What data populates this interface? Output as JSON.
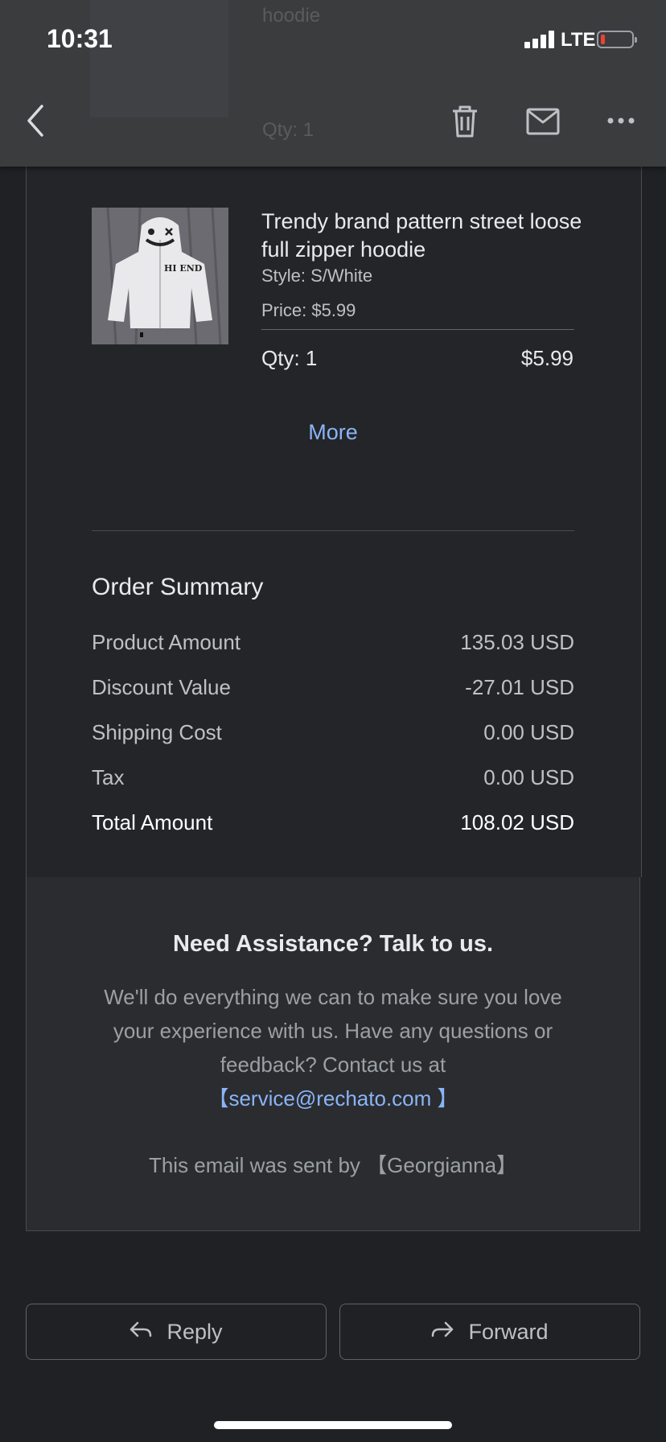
{
  "status_bar": {
    "time": "10:31",
    "network": "LTE"
  },
  "header": {
    "ghost_lines": [
      "hoodie",
      "Qty: 1"
    ]
  },
  "product": {
    "title": "Trendy brand pattern street loose full zipper hoodie",
    "style": "Style: S/White",
    "price": "Price: $5.99",
    "qty": "Qty: 1",
    "line_total": "$5.99",
    "image_text": "HI END"
  },
  "more_link": "More",
  "order_summary": {
    "title": "Order Summary",
    "rows": [
      {
        "label": "Product Amount",
        "value": "135.03 USD"
      },
      {
        "label": "Discount Value",
        "value": "-27.01 USD"
      },
      {
        "label": "Shipping Cost",
        "value": "0.00 USD"
      },
      {
        "label": "Tax",
        "value": "0.00 USD"
      },
      {
        "label": "Total Amount",
        "value": "108.02 USD"
      }
    ]
  },
  "assistance": {
    "title": "Need Assistance? Talk to us.",
    "body": "We'll do everything we can to make sure you love your experience with us. Have any questions or feedback? Contact us at ",
    "email": "【service@rechato.com 】",
    "sent_by": "This email was sent by 【Georgianna】"
  },
  "actions": {
    "reply": "Reply",
    "forward": "Forward"
  },
  "colors": {
    "background": "#202124",
    "header": "#3b3c3e",
    "link": "#8ab4f8",
    "battery_low": "#ea4335"
  },
  "icons": [
    "back-chevron-icon",
    "trash-icon",
    "mail-icon",
    "more-dots-icon",
    "reply-arrow-icon",
    "forward-arrow-icon"
  ]
}
